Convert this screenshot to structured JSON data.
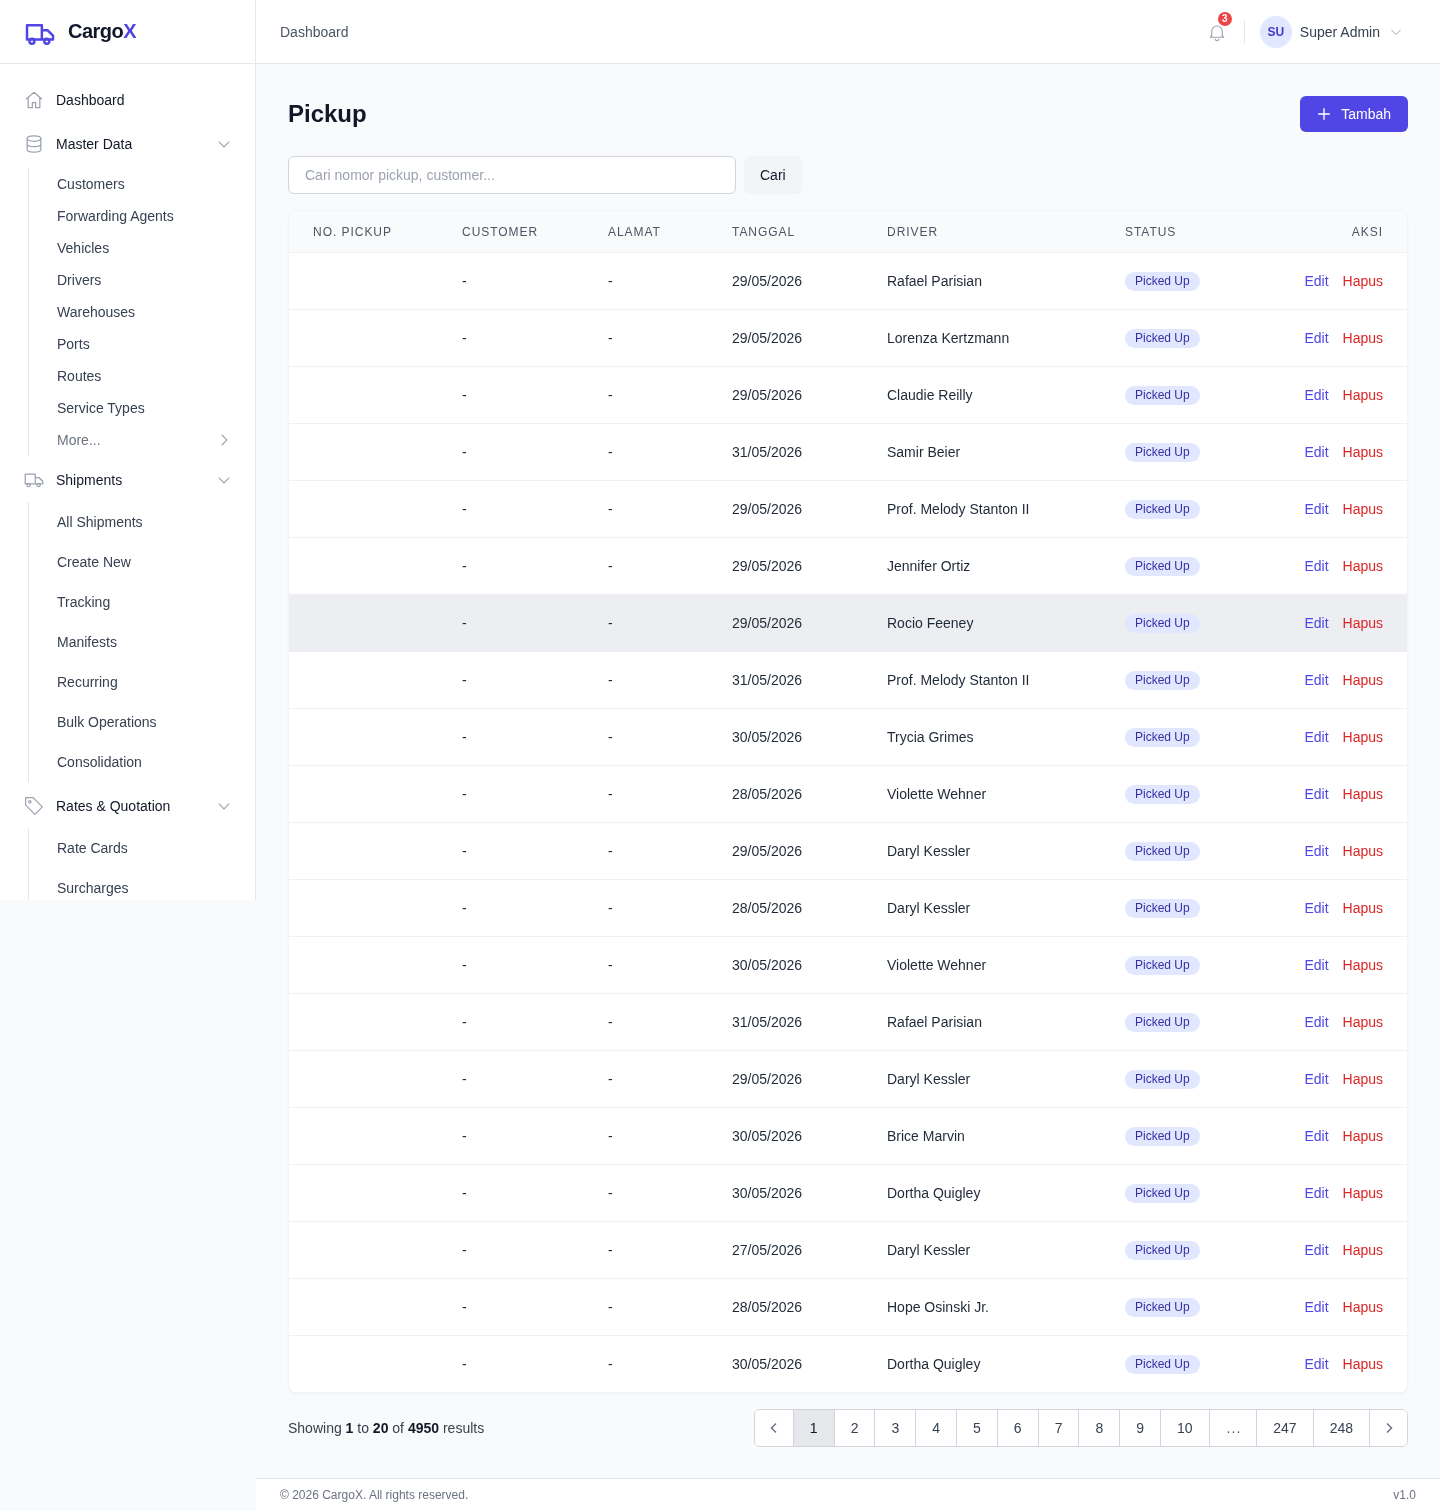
{
  "sidebar": {
    "brand": {
      "name": "Cargo",
      "accent": "X"
    },
    "nav": [
      {
        "label": "Dashboard",
        "kind": "link"
      },
      {
        "label": "Master Data",
        "kind": "group",
        "expanded": true,
        "children": [
          {
            "label": "Customers",
            "kind": "link"
          },
          {
            "label": "Forwarding Agents",
            "kind": "link"
          },
          {
            "label": "Vehicles",
            "kind": "link"
          },
          {
            "label": "Drivers",
            "kind": "link"
          },
          {
            "label": "Warehouses",
            "kind": "link"
          },
          {
            "label": "Ports",
            "kind": "link"
          },
          {
            "label": "Routes",
            "kind": "link"
          },
          {
            "label": "Service Types",
            "kind": "link"
          },
          {
            "label": "More...",
            "kind": "more"
          }
        ]
      },
      {
        "label": "Shipments",
        "kind": "group",
        "expanded": true,
        "children": [
          {
            "label": "All Shipments",
            "kind": "link"
          },
          {
            "label": "Create New",
            "kind": "link"
          },
          {
            "label": "Tracking",
            "kind": "link"
          },
          {
            "label": "Manifests",
            "kind": "link"
          },
          {
            "label": "Recurring",
            "kind": "link"
          },
          {
            "label": "Bulk Operations",
            "kind": "link"
          },
          {
            "label": "Consolidation",
            "kind": "link"
          }
        ]
      },
      {
        "label": "Rates & Quotation",
        "kind": "group",
        "expanded": true,
        "children": [
          {
            "label": "Rate Cards",
            "kind": "link"
          },
          {
            "label": "Surcharges",
            "kind": "link"
          }
        ]
      }
    ]
  },
  "header": {
    "breadcrumb": "Dashboard",
    "notifications": "3",
    "user": {
      "initials": "SU",
      "name": "Super Admin"
    }
  },
  "page": {
    "title": "Pickup",
    "add_button": "Tambah",
    "search": {
      "placeholder": "Cari nomor pickup, customer..."
    },
    "search_button": "Cari"
  },
  "table": {
    "columns": [
      "NO. PICKUP",
      "CUSTOMER",
      "ALAMAT",
      "TANGGAL",
      "DRIVER",
      "STATUS",
      "AKSI"
    ],
    "rows": [
      {
        "customer": "-",
        "address": "-",
        "date": "29/05/2026",
        "driver": "Rafael Parisian",
        "status": "Picked Up",
        "hovered": false,
        "actions": [
          {
            "label": "Edit",
            "kind": "edit"
          },
          {
            "label": "Hapus",
            "kind": "delete"
          }
        ]
      },
      {
        "customer": "-",
        "address": "-",
        "date": "29/05/2026",
        "driver": "Lorenza Kertzmann",
        "status": "Picked Up",
        "hovered": false,
        "actions": [
          {
            "label": "Edit",
            "kind": "edit"
          },
          {
            "label": "Hapus",
            "kind": "delete"
          }
        ]
      },
      {
        "customer": "-",
        "address": "-",
        "date": "29/05/2026",
        "driver": "Claudie Reilly",
        "status": "Picked Up",
        "hovered": false,
        "actions": [
          {
            "label": "Edit",
            "kind": "edit"
          },
          {
            "label": "Hapus",
            "kind": "delete"
          }
        ]
      },
      {
        "customer": "-",
        "address": "-",
        "date": "31/05/2026",
        "driver": "Samir Beier",
        "status": "Picked Up",
        "hovered": false,
        "actions": [
          {
            "label": "Edit",
            "kind": "edit"
          },
          {
            "label": "Hapus",
            "kind": "delete"
          }
        ]
      },
      {
        "customer": "-",
        "address": "-",
        "date": "29/05/2026",
        "driver": "Prof. Melody Stanton II",
        "status": "Picked Up",
        "hovered": false,
        "actions": [
          {
            "label": "Edit",
            "kind": "edit"
          },
          {
            "label": "Hapus",
            "kind": "delete"
          }
        ]
      },
      {
        "customer": "-",
        "address": "-",
        "date": "29/05/2026",
        "driver": "Jennifer Ortiz",
        "status": "Picked Up",
        "hovered": false,
        "actions": [
          {
            "label": "Edit",
            "kind": "edit"
          },
          {
            "label": "Hapus",
            "kind": "delete"
          }
        ]
      },
      {
        "customer": "-",
        "address": "-",
        "date": "29/05/2026",
        "driver": "Rocio Feeney",
        "status": "Picked Up",
        "hovered": true,
        "actions": [
          {
            "label": "Edit",
            "kind": "edit"
          },
          {
            "label": "Hapus",
            "kind": "delete"
          }
        ]
      },
      {
        "customer": "-",
        "address": "-",
        "date": "31/05/2026",
        "driver": "Prof. Melody Stanton II",
        "status": "Picked Up",
        "hovered": false,
        "actions": [
          {
            "label": "Edit",
            "kind": "edit"
          },
          {
            "label": "Hapus",
            "kind": "delete"
          }
        ]
      },
      {
        "customer": "-",
        "address": "-",
        "date": "30/05/2026",
        "driver": "Trycia Grimes",
        "status": "Picked Up",
        "hovered": false,
        "actions": [
          {
            "label": "Edit",
            "kind": "edit"
          },
          {
            "label": "Hapus",
            "kind": "delete"
          }
        ]
      },
      {
        "customer": "-",
        "address": "-",
        "date": "28/05/2026",
        "driver": "Violette Wehner",
        "status": "Picked Up",
        "hovered": false,
        "actions": [
          {
            "label": "Edit",
            "kind": "edit"
          },
          {
            "label": "Hapus",
            "kind": "delete"
          }
        ]
      },
      {
        "customer": "-",
        "address": "-",
        "date": "29/05/2026",
        "driver": "Daryl Kessler",
        "status": "Picked Up",
        "hovered": false,
        "actions": [
          {
            "label": "Edit",
            "kind": "edit"
          },
          {
            "label": "Hapus",
            "kind": "delete"
          }
        ]
      },
      {
        "customer": "-",
        "address": "-",
        "date": "28/05/2026",
        "driver": "Daryl Kessler",
        "status": "Picked Up",
        "hovered": false,
        "actions": [
          {
            "label": "Edit",
            "kind": "edit"
          },
          {
            "label": "Hapus",
            "kind": "delete"
          }
        ]
      },
      {
        "customer": "-",
        "address": "-",
        "date": "30/05/2026",
        "driver": "Violette Wehner",
        "status": "Picked Up",
        "hovered": false,
        "actions": [
          {
            "label": "Edit",
            "kind": "edit"
          },
          {
            "label": "Hapus",
            "kind": "delete"
          }
        ]
      },
      {
        "customer": "-",
        "address": "-",
        "date": "31/05/2026",
        "driver": "Rafael Parisian",
        "status": "Picked Up",
        "hovered": false,
        "actions": [
          {
            "label": "Edit",
            "kind": "edit"
          },
          {
            "label": "Hapus",
            "kind": "delete"
          }
        ]
      },
      {
        "customer": "-",
        "address": "-",
        "date": "29/05/2026",
        "driver": "Daryl Kessler",
        "status": "Picked Up",
        "hovered": false,
        "actions": [
          {
            "label": "Edit",
            "kind": "edit"
          },
          {
            "label": "Hapus",
            "kind": "delete"
          }
        ]
      },
      {
        "customer": "-",
        "address": "-",
        "date": "30/05/2026",
        "driver": "Brice Marvin",
        "status": "Picked Up",
        "hovered": false,
        "actions": [
          {
            "label": "Edit",
            "kind": "edit"
          },
          {
            "label": "Hapus",
            "kind": "delete"
          }
        ]
      },
      {
        "customer": "-",
        "address": "-",
        "date": "30/05/2026",
        "driver": "Dortha Quigley",
        "status": "Picked Up",
        "hovered": false,
        "actions": [
          {
            "label": "Edit",
            "kind": "edit"
          },
          {
            "label": "Hapus",
            "kind": "delete"
          }
        ]
      },
      {
        "customer": "-",
        "address": "-",
        "date": "27/05/2026",
        "driver": "Daryl Kessler",
        "status": "Picked Up",
        "hovered": false,
        "actions": [
          {
            "label": "Edit",
            "kind": "edit"
          },
          {
            "label": "Hapus",
            "kind": "delete"
          }
        ]
      },
      {
        "customer": "-",
        "address": "-",
        "date": "28/05/2026",
        "driver": "Hope Osinski Jr.",
        "status": "Picked Up",
        "hovered": false,
        "actions": [
          {
            "label": "Edit",
            "kind": "edit"
          },
          {
            "label": "Hapus",
            "kind": "delete"
          }
        ]
      },
      {
        "customer": "-",
        "address": "-",
        "date": "30/05/2026",
        "driver": "Dortha Quigley",
        "status": "Picked Up",
        "hovered": false,
        "actions": [
          {
            "label": "Edit",
            "kind": "edit"
          },
          {
            "label": "Hapus",
            "kind": "delete"
          }
        ]
      }
    ]
  },
  "pagination": {
    "summary": "Showing **1** to **20** of **4950** results",
    "pages": [
      {
        "label": "1",
        "kind": "page",
        "selected": true
      },
      {
        "label": "2",
        "kind": "page",
        "selected": false
      },
      {
        "label": "3",
        "kind": "page",
        "selected": false
      },
      {
        "label": "4",
        "kind": "page",
        "selected": false
      },
      {
        "label": "5",
        "kind": "page",
        "selected": false
      },
      {
        "label": "6",
        "kind": "page",
        "selected": false
      },
      {
        "label": "7",
        "kind": "page",
        "selected": false
      },
      {
        "label": "8",
        "kind": "page",
        "selected": false
      },
      {
        "label": "9",
        "kind": "page",
        "selected": false
      },
      {
        "label": "10",
        "kind": "page",
        "selected": false
      },
      {
        "label": "...",
        "kind": "ellipsis",
        "selected": false
      },
      {
        "label": "247",
        "kind": "page",
        "selected": false
      },
      {
        "label": "248",
        "kind": "page",
        "selected": false
      }
    ]
  },
  "footer": {
    "copyright": "© 2026 CargoX. All rights reserved.",
    "version": "v1.0"
  }
}
